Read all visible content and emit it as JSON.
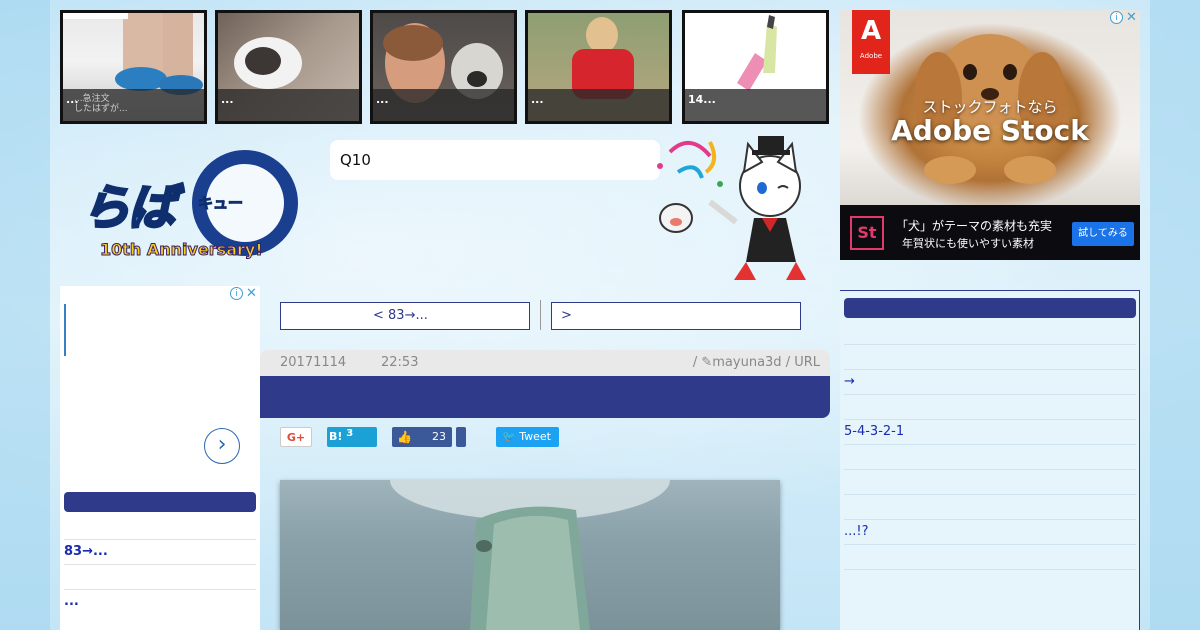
{
  "thumbnails": [
    {
      "caption": "...",
      "sub": "...急注文\nしたはずが..."
    },
    {
      "caption": "...",
      "sub": ""
    },
    {
      "caption": "...",
      "sub": ""
    },
    {
      "caption": "...",
      "sub": ""
    },
    {
      "caption": "14...",
      "sub": ""
    }
  ],
  "ad_top": {
    "brand": "Adobe",
    "line1": "ストックフォトなら",
    "line2": "Adobe Stock",
    "st_label": "St",
    "bottom_line1": "「犬」がテーマの素材も充実",
    "bottom_line2": "年賀状にも使いやすい素材",
    "cta": "試してみる"
  },
  "logo": {
    "main": "らば",
    "kyu": "キュー",
    "anniversary": "10th Anniversary!"
  },
  "search": {
    "value": "Q10"
  },
  "left_panel": {
    "rows": [
      "",
      "83→...",
      "",
      "..."
    ]
  },
  "nav": {
    "prev_label": "< 83→...",
    "next_label": ">"
  },
  "meta": {
    "date": "20171114",
    "time": "22:53",
    "author_line": "/ ✎mayuna3d / URL"
  },
  "share": {
    "gplus": "G+",
    "hatena": "B!",
    "hatena_count": "3",
    "like_count": "23",
    "tweet": "Tweet"
  },
  "right_panel": {
    "rows": [
      "",
      "",
      "→",
      "",
      "5-4-3-2-1",
      "",
      "",
      "",
      "...!?",
      ""
    ]
  },
  "colors": {
    "navy": "#2f3a8a",
    "link": "#1a2bb0",
    "hatena": "#1ba1d6",
    "facebook": "#3b5998",
    "twitter": "#1da1f2"
  }
}
